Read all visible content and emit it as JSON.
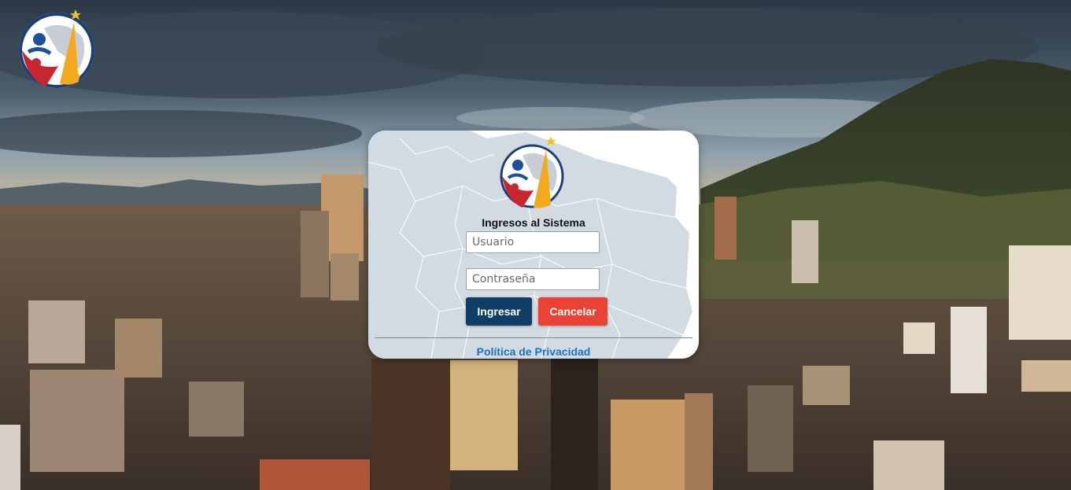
{
  "login": {
    "title": "Ingresos al Sistema",
    "username_placeholder": "Usuario",
    "password_placeholder": "Contraseña",
    "submit_label": "Ingresar",
    "cancel_label": "Cancelar",
    "privacy_link": "Política de Privacidad"
  },
  "colors": {
    "submit_button": "#103e66",
    "cancel_button": "#ea4335",
    "link": "#1a73c8"
  },
  "icons": {
    "corner_logo": "emblem-logo-icon",
    "card_logo": "emblem-logo-icon",
    "card_background": "colombia-map-icon"
  }
}
